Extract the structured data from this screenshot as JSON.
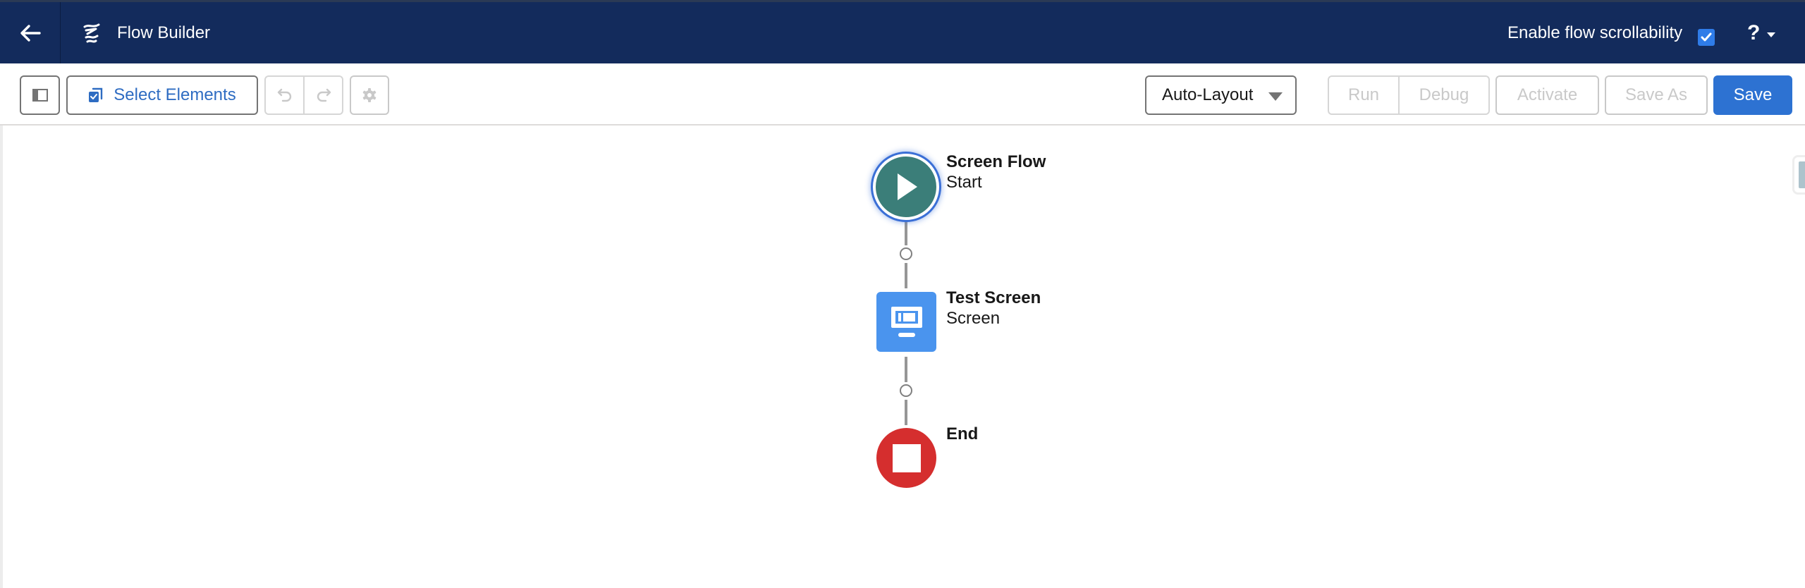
{
  "header": {
    "back_icon": "arrow-left-icon",
    "app_icon": "flow-icon",
    "title": "Flow Builder",
    "scrollability_label": "Enable flow scrollability",
    "scrollability_checked": true,
    "help_label": "?"
  },
  "toolbar": {
    "toggle_panel_icon": "left-panel-icon",
    "select_elements_label": "Select Elements",
    "undo_icon": "undo-icon",
    "redo_icon": "redo-icon",
    "settings_icon": "gear-icon",
    "layout_select": {
      "value": "Auto-Layout"
    },
    "run_label": "Run",
    "debug_label": "Debug",
    "activate_label": "Activate",
    "save_as_label": "Save As",
    "save_label": "Save"
  },
  "canvas": {
    "nodes": [
      {
        "type": "start",
        "title": "Screen Flow",
        "subtitle": "Start",
        "color": "#3b7e79"
      },
      {
        "type": "screen",
        "title": "Test Screen",
        "subtitle": "Screen",
        "color": "#4a94ee"
      },
      {
        "type": "end",
        "title": "End",
        "subtitle": "",
        "color": "#d52e2e"
      }
    ]
  },
  "colors": {
    "header_bg": "#132b5c",
    "brand_blue": "#2d72d2",
    "link_blue": "#2e6cc2"
  }
}
